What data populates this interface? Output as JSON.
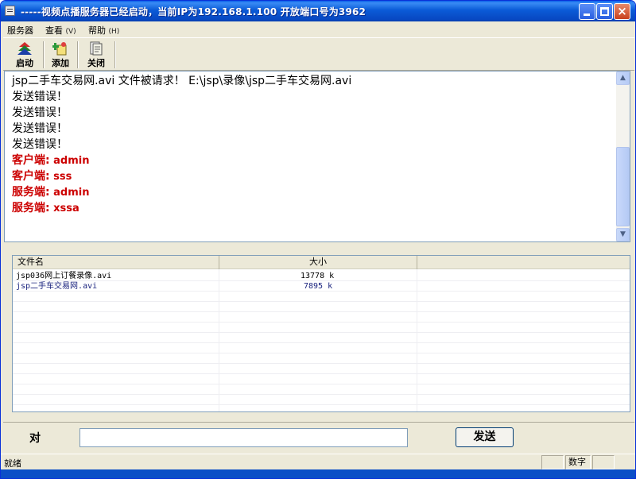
{
  "window": {
    "title": "-----视频点播服务器已经启动，当前IP为192.168.1.100  开放端口号为3962",
    "icon": "app-icon",
    "controls": {
      "minimize": "minimize-icon",
      "maximize": "maximize-icon",
      "close": "×"
    }
  },
  "menubar": {
    "items": [
      {
        "label": "服务器",
        "mnemonic": ""
      },
      {
        "label": "查看",
        "mnemonic": "(V)"
      },
      {
        "label": "帮助",
        "mnemonic": "(H)"
      }
    ]
  },
  "toolbar": {
    "start_label": "启动",
    "add_label": "添加",
    "close_label": "关闭"
  },
  "log": {
    "lines": [
      {
        "text": "jsp二手车交易网.avi 文件被请求！ E:\\jsp\\录像\\jsp二手车交易网.avi",
        "color": "#000000"
      },
      {
        "text": "发送错误！",
        "color": "#000000"
      },
      {
        "text": "发送错误！",
        "color": "#000000"
      },
      {
        "text": "发送错误！",
        "color": "#000000"
      },
      {
        "text": "发送错误！",
        "color": "#000000"
      },
      {
        "label": "客户端:",
        "value": " admin",
        "color": "#cc0000"
      },
      {
        "label": "客户端:",
        "value": " sss",
        "color": "#cc0000"
      },
      {
        "label": "服务端:",
        "value": " admin",
        "color": "#cc0000"
      },
      {
        "label": "服务端:",
        "value": " xssa",
        "color": "#cc0000"
      }
    ]
  },
  "filelist": {
    "columns": [
      "文件名",
      "大小",
      ""
    ],
    "rows": [
      {
        "name": "jsp036网上订餐录像.avi",
        "size": "13778 k",
        "color": "#000000"
      },
      {
        "name": "jsp二手车交易网.avi",
        "size": "7895 k",
        "color": "#1a237e"
      }
    ]
  },
  "chat": {
    "to_label": "对",
    "input_value": "",
    "send_label": "发送"
  },
  "status": {
    "text": "就绪",
    "panel_num": "数字"
  },
  "colors": {
    "titlebar": "#0b5bd7",
    "error_text": "#cc0000",
    "selected_row_text": "#1a237e"
  }
}
